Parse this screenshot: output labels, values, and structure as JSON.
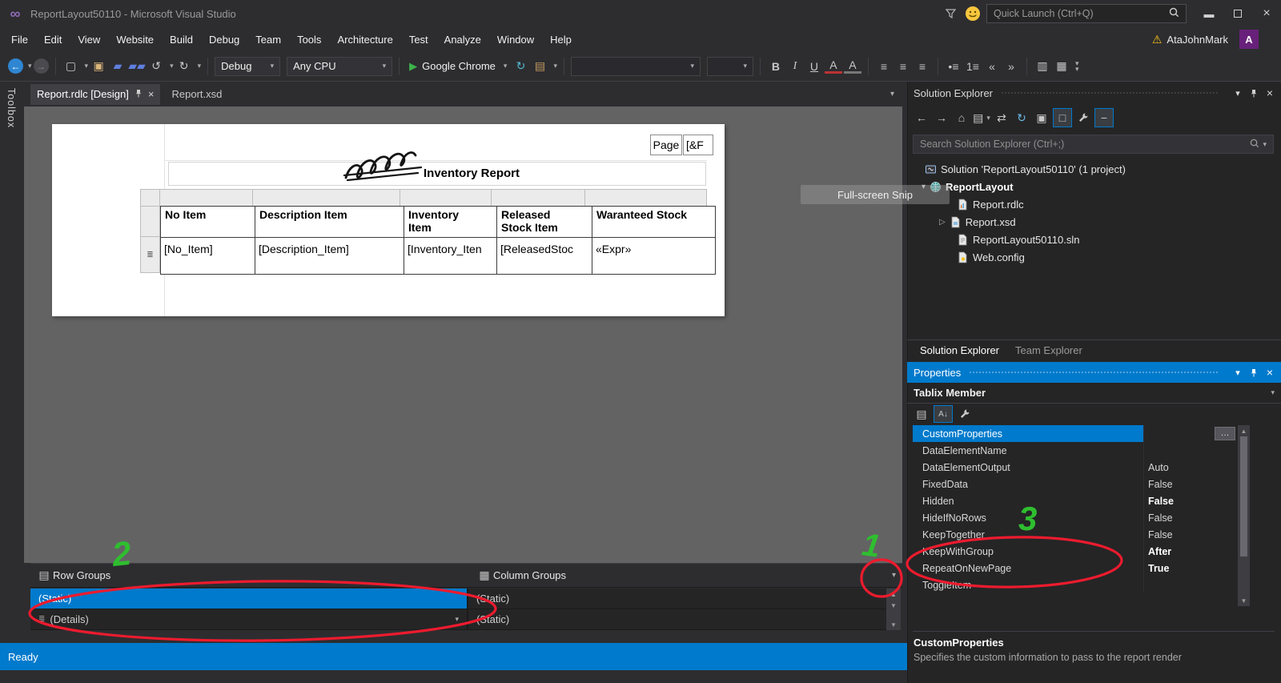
{
  "accent": {
    "blue": "#007acc",
    "annotation_red": "#ed1b2e",
    "annotation_green": "#2fbe2f"
  },
  "title_bar": {
    "title": "ReportLayout50110 - Microsoft Visual Studio",
    "quick_launch": "Quick Launch (Ctrl+Q)"
  },
  "menu": {
    "items": [
      "File",
      "Edit",
      "View",
      "Website",
      "Build",
      "Debug",
      "Team",
      "Tools",
      "Architecture",
      "Test",
      "Analyze",
      "Window",
      "Help"
    ],
    "account_name": "AtaJohnMark",
    "avatar_letter": "A"
  },
  "toolbar": {
    "config": "Debug",
    "platform": "Any CPU",
    "run_target": "Google Chrome",
    "bold": "B",
    "italic": "I",
    "underline": "U"
  },
  "toolbox_tab": "Toolbox",
  "document_tabs": [
    {
      "label": "Report.rdlc [Design]"
    },
    {
      "label": "Report.xsd"
    }
  ],
  "designer": {
    "page_header_box1": "Page",
    "page_header_box2": "[&F",
    "report_title": "Inventory Report",
    "snip_overlay": "Full-screen Snip",
    "table": {
      "headers": [
        "No Item",
        "Description Item",
        "Inventory Item",
        "Released Stock Item",
        "Waranteed Stock"
      ],
      "data_row": [
        "[No_Item]",
        "[Description_Item]",
        "[Inventory_Iten",
        "[ReleasedStoc",
        "«Expr»"
      ]
    }
  },
  "grouping_pane": {
    "row_groups_label": "Row Groups",
    "column_groups_label": "Column Groups",
    "row_groups": [
      {
        "label": "(Static)"
      },
      {
        "label": "(Details)"
      }
    ],
    "column_groups": [
      {
        "label": "(Static)"
      },
      {
        "label": "(Static)"
      }
    ]
  },
  "solution_explorer": {
    "title": "Solution Explorer",
    "search_placeholder": "Search Solution Explorer (Ctrl+;)",
    "tree": [
      {
        "label": "Solution 'ReportLayout50110' (1 project)"
      },
      {
        "label": "ReportLayout"
      },
      {
        "label": "Report.rdlc"
      },
      {
        "label": "Report.xsd"
      },
      {
        "label": "ReportLayout50110.sln"
      },
      {
        "label": "Web.config"
      }
    ],
    "bottom_tabs": [
      {
        "label": "Solution Explorer"
      },
      {
        "label": "Team Explorer"
      }
    ]
  },
  "properties_panel": {
    "title": "Properties",
    "object_name": "Tablix Member",
    "rows": [
      {
        "name": "CustomProperties",
        "value": ""
      },
      {
        "name": "DataElementName",
        "value": ""
      },
      {
        "name": "DataElementOutput",
        "value": "Auto"
      },
      {
        "name": "FixedData",
        "value": "False"
      },
      {
        "name": "Hidden",
        "value": "False"
      },
      {
        "name": "HideIfNoRows",
        "value": "False"
      },
      {
        "name": "KeepTogether",
        "value": "False"
      },
      {
        "name": "KeepWithGroup",
        "value": "After"
      },
      {
        "name": "RepeatOnNewPage",
        "value": "True"
      },
      {
        "name": "ToggleItem",
        "value": ""
      }
    ],
    "ellipsis_button": "…",
    "description_title": "CustomProperties",
    "description_text": "Specifies the custom information to pass to the report render"
  },
  "status_bar": {
    "text": "Ready"
  },
  "annotations": {
    "label_1": "1",
    "label_2": "2",
    "label_3": "3"
  }
}
